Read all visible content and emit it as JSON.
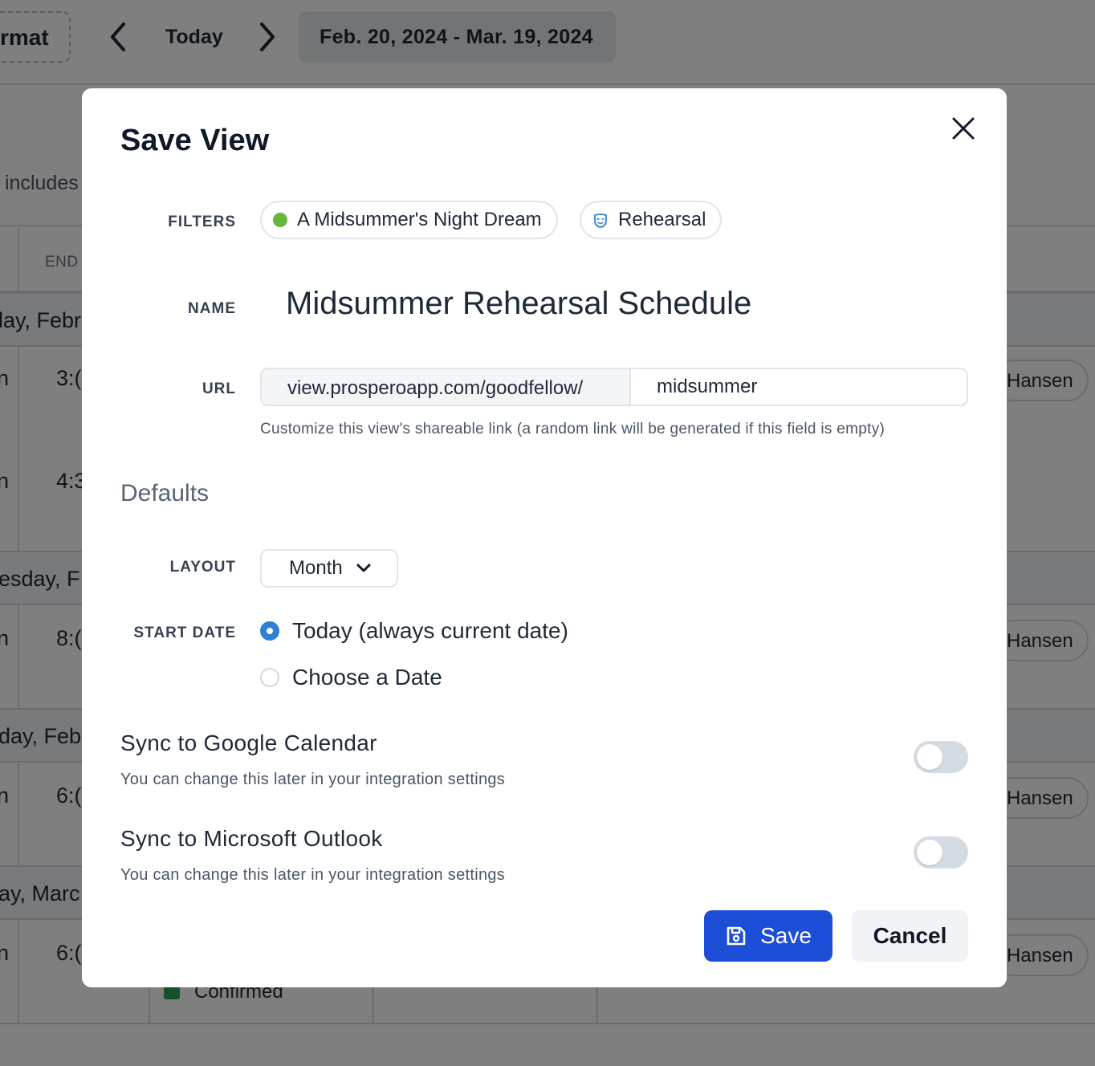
{
  "background": {
    "format_label": "rmat",
    "today_label": "Today",
    "date_range": "Feb. 20, 2024 - Mar. 19, 2024",
    "filter_text": "includes",
    "end_header": "END",
    "days": [
      "lay, Febr",
      "esday, F",
      "day, Feb",
      "ay, Marc"
    ],
    "times": [
      "3:(",
      "4:3",
      "8:(",
      "6:(",
      "6:("
    ],
    "row_prefix": "n",
    "assignee": "Hansen",
    "status": "Confirmed"
  },
  "modal": {
    "title": "Save View",
    "filters_label": "FILTERS",
    "filters": [
      {
        "label": "A Midsummer's Night Dream",
        "icon": "green-dot-icon",
        "color": "#67b73f"
      },
      {
        "label": "Rehearsal",
        "icon": "theater-mask-icon",
        "color": "#2f7fd4"
      }
    ],
    "name_label": "NAME",
    "name_value": "Midsummer Rehearsal Schedule",
    "url_label": "URL",
    "url_prefix": "view.prosperoapp.com/goodfellow/",
    "url_slug": "midsummer",
    "url_help": "Customize this view's shareable link (a random link will be generated if this field is empty)",
    "defaults_title": "Defaults",
    "layout_label": "LAYOUT",
    "layout_value": "Month",
    "start_date_label": "START DATE",
    "start_options": [
      {
        "label": "Today (always current date)",
        "selected": true
      },
      {
        "label": "Choose a Date",
        "selected": false
      }
    ],
    "google_sync": {
      "title": "Sync to Google Calendar",
      "subtitle": "You can change this later in your integration settings",
      "enabled": false
    },
    "outlook_sync": {
      "title": "Sync to Microsoft Outlook",
      "subtitle": "You can change this later in your integration settings",
      "enabled": false
    },
    "save_label": "Save",
    "cancel_label": "Cancel"
  },
  "colors": {
    "primary": "#1d4ed8",
    "radio_selected": "#2f7fd4",
    "production_dot": "#67b73f",
    "toggle_off": "#d5dbe3"
  }
}
